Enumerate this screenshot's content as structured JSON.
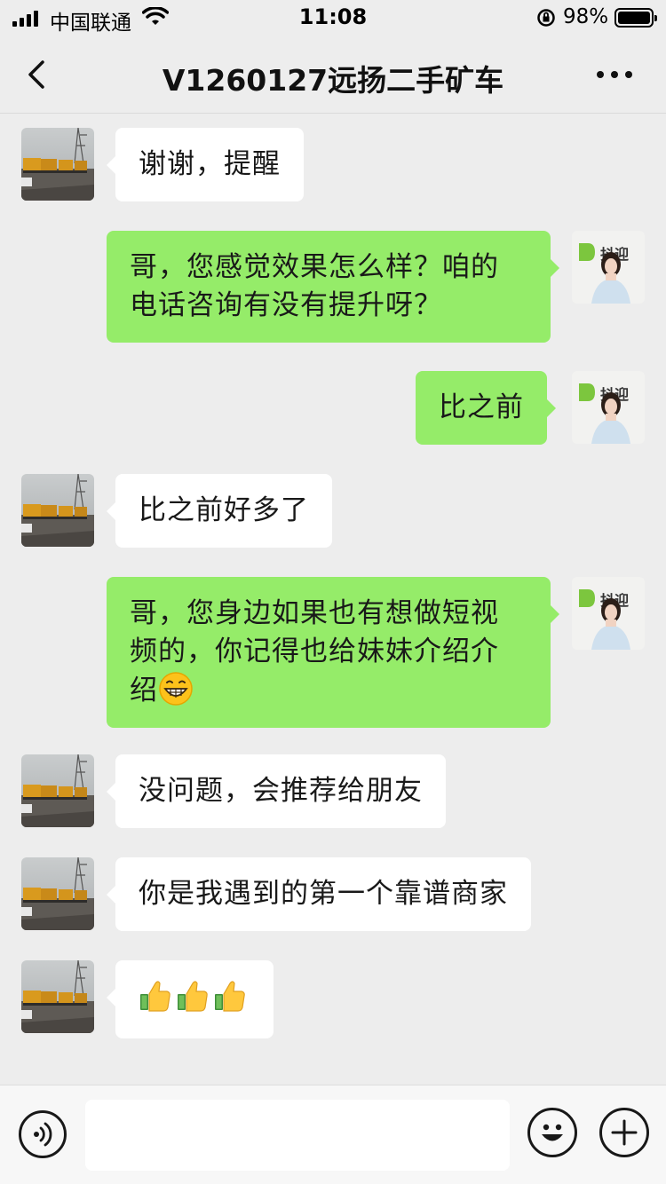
{
  "status_bar": {
    "carrier": "中国联通",
    "time": "11:08",
    "battery": "98%",
    "battery_level": 0.98
  },
  "header": {
    "title": "V1260127远扬二手矿车"
  },
  "messages": [
    {
      "side": "in",
      "text": "谢谢，提醒"
    },
    {
      "side": "out",
      "lines": [
        "哥，您感觉效果怎么样？咱的",
        "电话咨询有没有提升呀？"
      ]
    },
    {
      "side": "out",
      "text": "比之前"
    },
    {
      "side": "in",
      "text": "比之前好多了"
    },
    {
      "side": "out",
      "lines": [
        "哥，您身边如果也有想做短视",
        "频的，你记得也给妹妹介绍介",
        "绍"
      ],
      "trailing_emoji": "grinning-face-emoji"
    },
    {
      "side": "in",
      "text": "没问题，会推荐给朋友"
    },
    {
      "side": "in",
      "text": "你是我遇到的第一个靠谱商家"
    },
    {
      "side": "in",
      "emojis": [
        "thumbs-up-emoji",
        "thumbs-up-emoji",
        "thumbs-up-emoji"
      ]
    }
  ],
  "avatars": {
    "contact": "truck-yard-photo",
    "self_logo_text": "抖迎"
  },
  "colors": {
    "background": "#EDEDED",
    "outgoing_bubble": "#95EC69",
    "incoming_bubble": "#FFFFFF",
    "input_bar": "#F7F7F7"
  },
  "input": {
    "value": "",
    "icons": [
      "voice-icon",
      "emoji-icon",
      "plus-icon"
    ]
  }
}
